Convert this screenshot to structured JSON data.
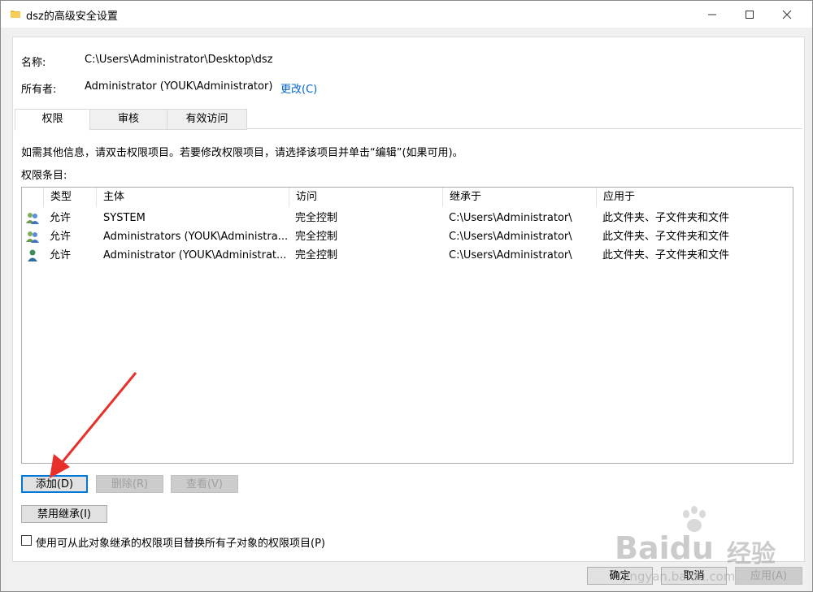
{
  "window": {
    "title": "dsz的高级安全设置",
    "minimize_glyph": "—",
    "maximize_glyph": "☐",
    "close_glyph": "✕"
  },
  "info": {
    "name_label": "名称:",
    "name_value": "C:\\Users\\Administrator\\Desktop\\dsz",
    "owner_label": "所有者:",
    "owner_value": "Administrator (YOUK\\Administrator)",
    "change_link": "更改(C)"
  },
  "tabs": [
    {
      "label": "权限",
      "active": true
    },
    {
      "label": "审核",
      "active": false
    },
    {
      "label": "有效访问",
      "active": false
    }
  ],
  "permissions": {
    "instructions": "如需其他信息，请双击权限项目。若要修改权限项目，请选择该项目并单击“编辑”(如果可用)。",
    "entries_label": "权限条目:",
    "columns": [
      "类型",
      "主体",
      "访问",
      "继承于",
      "应用于"
    ],
    "rows": [
      {
        "icon": "group-users-icon",
        "type": "允许",
        "principal": "SYSTEM",
        "access": "完全控制",
        "inherited_from": "C:\\Users\\Administrator\\",
        "applies_to": "此文件夹、子文件夹和文件"
      },
      {
        "icon": "group-users-icon",
        "type": "允许",
        "principal": "Administrators (YOUK\\Administra...",
        "access": "完全控制",
        "inherited_from": "C:\\Users\\Administrator\\",
        "applies_to": "此文件夹、子文件夹和文件"
      },
      {
        "icon": "user-icon",
        "type": "允许",
        "principal": "Administrator (YOUK\\Administrat...",
        "access": "完全控制",
        "inherited_from": "C:\\Users\\Administrator\\",
        "applies_to": "此文件夹、子文件夹和文件"
      }
    ]
  },
  "buttons": {
    "add": "添加(D)",
    "remove": "删除(R)",
    "view": "查看(V)",
    "disable_inheritance": "禁用继承(I)",
    "replace_checkbox_label": "使用可从此对象继承的权限项目替换所有子对象的权限项目(P)",
    "ok": "确定",
    "cancel": "取消",
    "apply": "应用(A)"
  },
  "watermark": {
    "brand": "Baidu",
    "brand_suffix": "经验",
    "url": "jingyan.baidu.com"
  },
  "colors": {
    "link": "#0066cc",
    "annotation_arrow": "#e8302a",
    "focus_border": "#0078d7"
  }
}
